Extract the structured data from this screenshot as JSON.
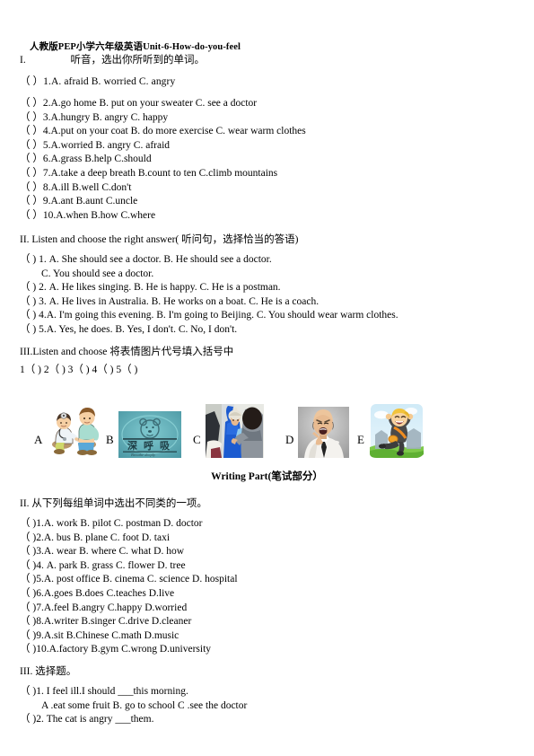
{
  "document": {
    "title": "人教版PEP小学六年级英语Unit-6-How-do-you-feel"
  },
  "section1": {
    "heading_num": "I.",
    "heading_text": "听音，选出你所听到的单词。",
    "questions": [
      "（    ）1.A. afraid          B. worried           C. angry",
      "（ ）2.A.go home        B. put on your sweater  C. see a doctor",
      "（ ）3.A.hungry          B. angry              C. happy",
      "（ ）4.A.put on your coat  B. do more exercise    C. wear warm clothes",
      "（ ）5.A.worried         B. angry             C. afraid",
      "（ ）6.A.grass           B.help              C.should",
      "（ ）7.A.take a deep breath   B.count to ten      C.climb mountains",
      "（ ）8.A.ill              B.well             C.don't",
      "（ ）9.A.ant             B.aunt             C.uncle",
      "（ ）10.A.when          B.how              C.where"
    ]
  },
  "section2": {
    "heading": "II. Listen and choose the right answer( 听问句，选择恰当的答语)",
    "questions": [
      "（ ) 1. A. She should see a doctor.      B. He should see a doctor.",
      "C. You should see a doctor.",
      "（ ) 2. A. He likes singing.     B. He is happy.    C. He is a postman.",
      "（ ) 3. A. He lives in Australia.    B. He works on a boat.     C. He is a coach.",
      "（ ) 4.A. I'm going this evening.  B. I'm going to Beijing. C. You should wear warm clothes.",
      "（ ) 5.A. Yes, he does.        B. Yes, I don't.        C. No, I don't."
    ],
    "indent_flags": [
      false,
      true,
      false,
      false,
      false,
      false
    ]
  },
  "section3": {
    "heading": "III.Listen and choose 将表情图片代号填入括号中",
    "blanks": "1（ )          2（ )            3（ )             4（ )      5（ )",
    "pictures": [
      {
        "letter": "A",
        "name": "doctor-examining-boy-illustration",
        "alt": "卡通医生为男孩检查身体"
      },
      {
        "letter": "B",
        "name": "deep-breath-bear-sign",
        "alt": "深呼吸小熊标志"
      },
      {
        "letter": "C",
        "name": "person-helping-child-photo",
        "alt": "大人给孩子穿蓝色外套照片"
      },
      {
        "letter": "D",
        "name": "angry-man-shouting-photo",
        "alt": "生气的男人指着喊叫照片"
      },
      {
        "letter": "E",
        "name": "happy-running-person-illustration",
        "alt": "开心奔跑的卡通人物"
      }
    ]
  },
  "writing_part": {
    "label": "Writing Part(笔试部分）"
  },
  "section4": {
    "heading": "II. 从下列每组单词中选出不同类的一项。",
    "questions": [
      "（ )1.A. work  B. pilot  C. postman  D. doctor",
      "（ )2.A. bus  B. plane  C. foot  D. taxi",
      "（ )3.A. wear  B. where  C. what  D. how",
      "（ )4. A. park  B. grass  C. flower  D. tree",
      "（ )5.A. post office  B. cinema  C. science  D. hospital",
      "（ )6.A.goes    B.does     C.teaches      D.live",
      "（ )7.A.feel    B.angry    C.happy       D.worried",
      "（ )8.A.writer    B.singer    C.drive       D.cleaner",
      "（ )9.A.sit      B.Chinese   C.math       D.music",
      "（ )10.A.factory   B.gym     C.wrong      D.university"
    ]
  },
  "section5": {
    "heading": "III. 选择题。",
    "questions": [
      "（ )1. I feel ill.I should ___this morning.",
      "A .eat some fruit   B. go to school   C .see the doctor",
      "（ )2. The cat is angry ___them."
    ],
    "indent_flags": [
      false,
      true,
      false
    ]
  }
}
